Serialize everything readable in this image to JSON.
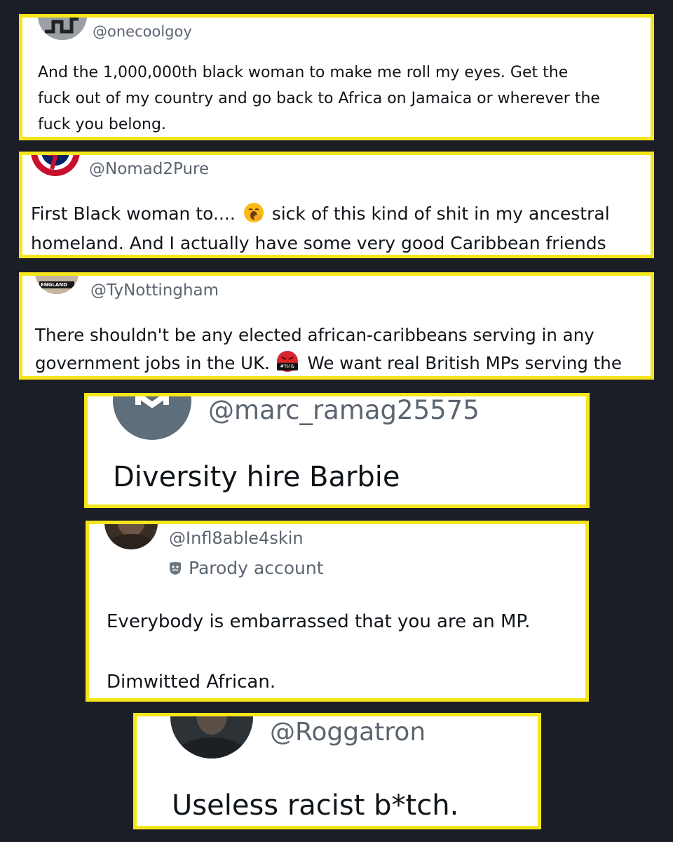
{
  "replies": [
    {
      "handle": "@onecoolgoy",
      "lines": [
        "And the 1,000,000th black woman to make me roll my eyes. Get the",
        "fuck out of my country and go back to Africa on Jamaica or wherever the",
        "fuck you belong."
      ]
    },
    {
      "handle": "@Nomad2Pure",
      "line1_before_emoji": "First Black woman to....",
      "emoji": "yawning-face-emoji",
      "line1_after_emoji": "sick of this kind of shit in my ancestral",
      "line2": "homeland. And I actually have some very good Caribbean friends"
    },
    {
      "handle": "@TyNottingham",
      "avatar_text": "ENGLAND",
      "line1": "There shouldn't be any elected african-caribbeans serving in any",
      "line2_before_emoji": "government jobs in the UK.",
      "emoji": "face-with-symbols-emoji",
      "emoji_text": "#%!&",
      "line2_after_emoji": "We want real British MPs serving the"
    },
    {
      "handle": "@marc_ramag25575",
      "text": "Diversity hire Barbie"
    },
    {
      "handle": "@Infl8able4skin",
      "parody_label": "Parody account",
      "line1": "Everybody is embarrassed that you are an MP.",
      "line2": "Dimwitted African."
    },
    {
      "handle": "@Roggatron",
      "text": "Useless racist b*tch."
    }
  ],
  "colors": {
    "background": "#1c1e26",
    "highlight_border": "#f5e51b",
    "handle_gray": "#5b6570",
    "text": "#0f1419"
  }
}
